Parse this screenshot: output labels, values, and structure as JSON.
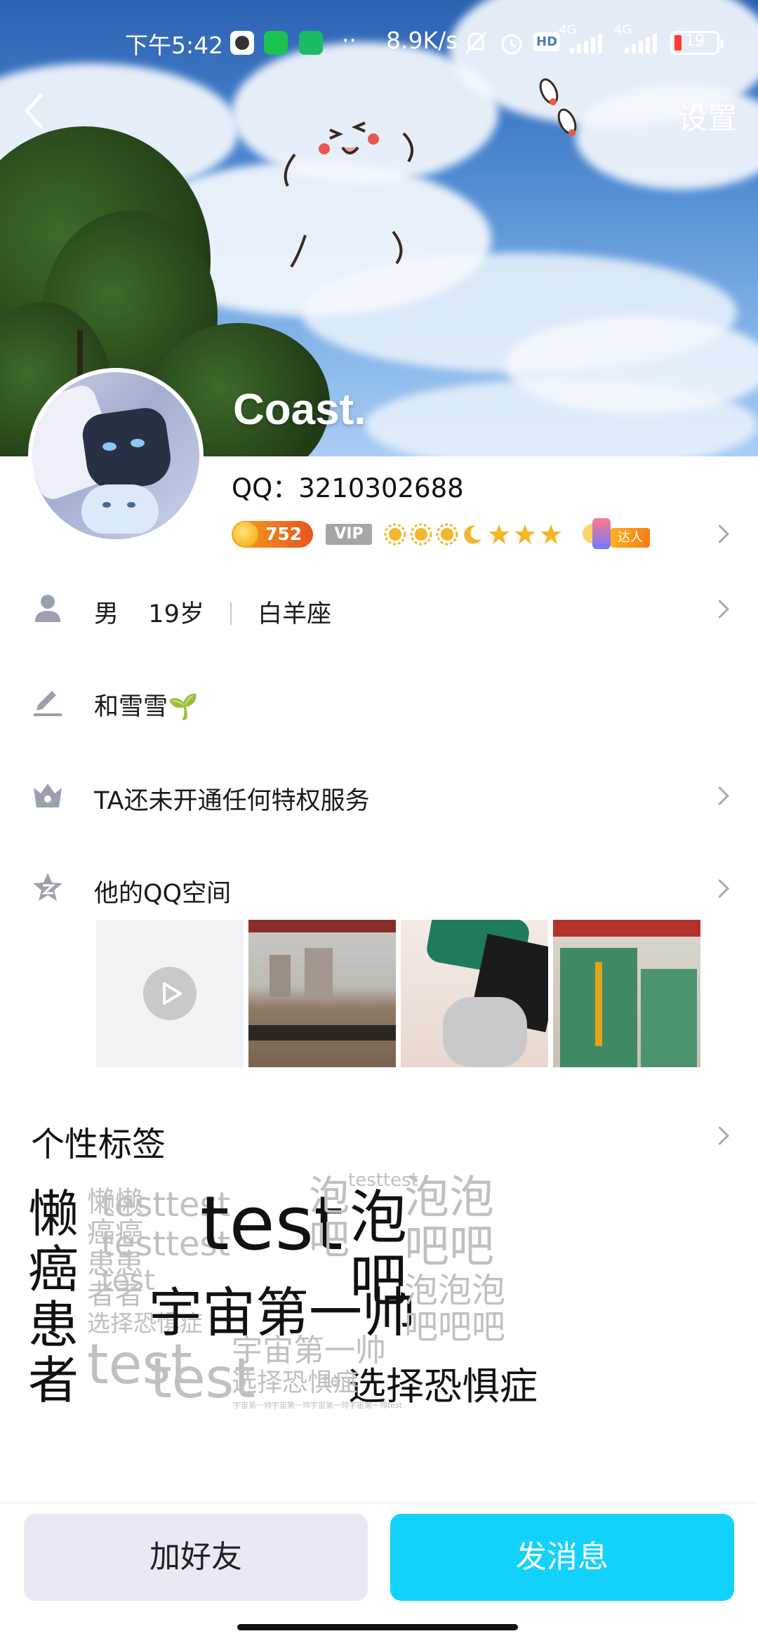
{
  "status_bar": {
    "time": "下午5:42",
    "dots": "··",
    "network_speed": "8.9K/s",
    "hd": "HD",
    "sig1": "4G",
    "sig2": "4G",
    "battery": "19"
  },
  "header": {
    "settings_label": "设置",
    "nickname": "Coast."
  },
  "profile": {
    "qq_label": "QQ：3210302688",
    "coins": "752",
    "vip": "VIP",
    "daren": "达人"
  },
  "info_rows": {
    "gender": "男",
    "age": "19岁",
    "zodiac": "白羊座",
    "signature": "和雪雪🌱",
    "privilege": "TA还未开通任何特权服务",
    "qzone": "他的QQ空间"
  },
  "tags": {
    "title": "个性标签",
    "items": {
      "a": "懒",
      "b": "癌",
      "c": "患",
      "d": "者",
      "e": "懒懒",
      "f": "癌癌",
      "g": "患患",
      "h": "者者",
      "i": "选择恐惧症",
      "j": "test",
      "k": "testtest",
      "l": "testtest",
      "m": "test",
      "n": "test",
      "o": "宇宙第一帅",
      "p": "泡",
      "q": "吧",
      "r": "testtest",
      "s": "泡",
      "t": "吧",
      "u": "泡泡",
      "v": "吧吧",
      "w": "泡泡泡",
      "x": "吧吧吧",
      "y": "选择恐惧症",
      "z": "宇宙第一帅",
      "aa": "选择恐惧症",
      "ab": "test",
      "ac": "宇宙第一帅宇宙第一帅宇宙第一帅宇宙第一帅test",
      "ad": "test"
    }
  },
  "actions": {
    "add_friend": "加好友",
    "send_message": "发消息"
  },
  "colors": {
    "accent": "#12d2fb",
    "add_bg": "#e8eaf3",
    "coin": "#f6a21e"
  }
}
